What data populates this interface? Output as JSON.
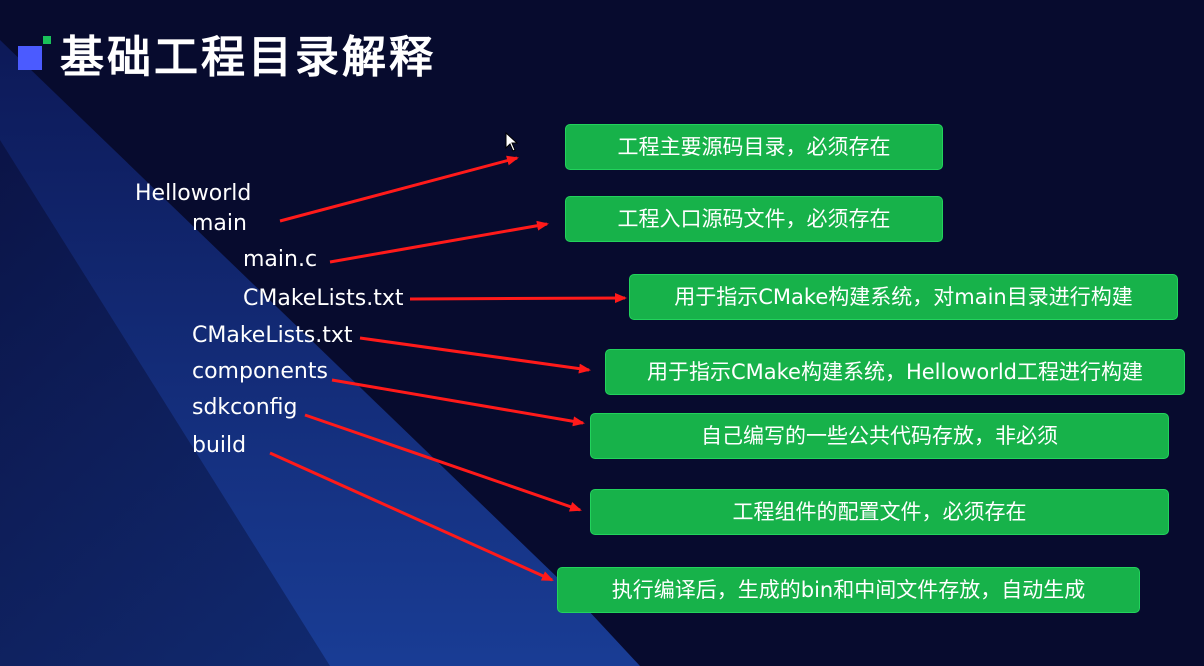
{
  "title": "基础工程目录解释",
  "tree": {
    "root": "Helloworld",
    "main": "main",
    "main_c": "main.c",
    "main_cmake": "CMakeLists.txt",
    "root_cmake": "CMakeLists.txt",
    "components": "components",
    "sdkconfig": "sdkconfig",
    "build": "build"
  },
  "notes": {
    "main_desc": "工程主要源码目录，必须存在",
    "main_c_desc": "工程入口源码文件，必须存在",
    "main_cmake_desc": "用于指示CMake构建系统，对main目录进行构建",
    "root_cmake_desc": "用于指示CMake构建系统，Helloworld工程进行构建",
    "components_desc": "自己编写的一些公共代码存放，非必须",
    "sdkconfig_desc": "工程组件的配置文件，必须存在",
    "build_desc": "执行编译后，生成的bin和中间文件存放，自动生成"
  },
  "colors": {
    "background": "#070b2e",
    "accent_blue": "#4b5bff",
    "accent_green": "#19c15a",
    "box_green": "#17b24a",
    "arrow_red": "#ff1a1a"
  }
}
